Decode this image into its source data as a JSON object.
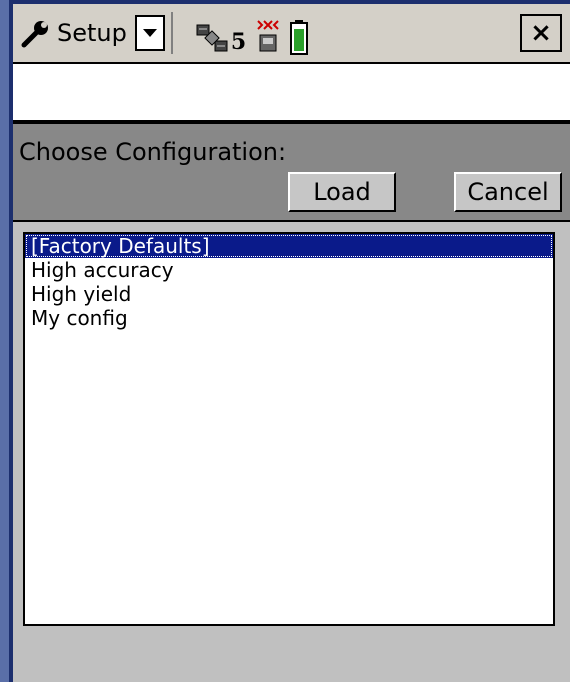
{
  "titlebar": {
    "app_label": "Setup",
    "satellite_count": "5",
    "close_label": "×"
  },
  "config": {
    "prompt": "Choose Configuration:",
    "load_label": "Load",
    "cancel_label": "Cancel"
  },
  "list": {
    "items": [
      "[Factory Defaults]",
      "High accuracy",
      "High yield",
      "My config"
    ],
    "selected_index": 0
  },
  "colors": {
    "selection": "#0a1a8a",
    "panel": "#888888",
    "frame": "#1c2f6e"
  },
  "icons": [
    "wrench-icon",
    "chevron-down-icon",
    "satellite-icon",
    "receiver-icon",
    "battery-icon",
    "close-icon"
  ]
}
